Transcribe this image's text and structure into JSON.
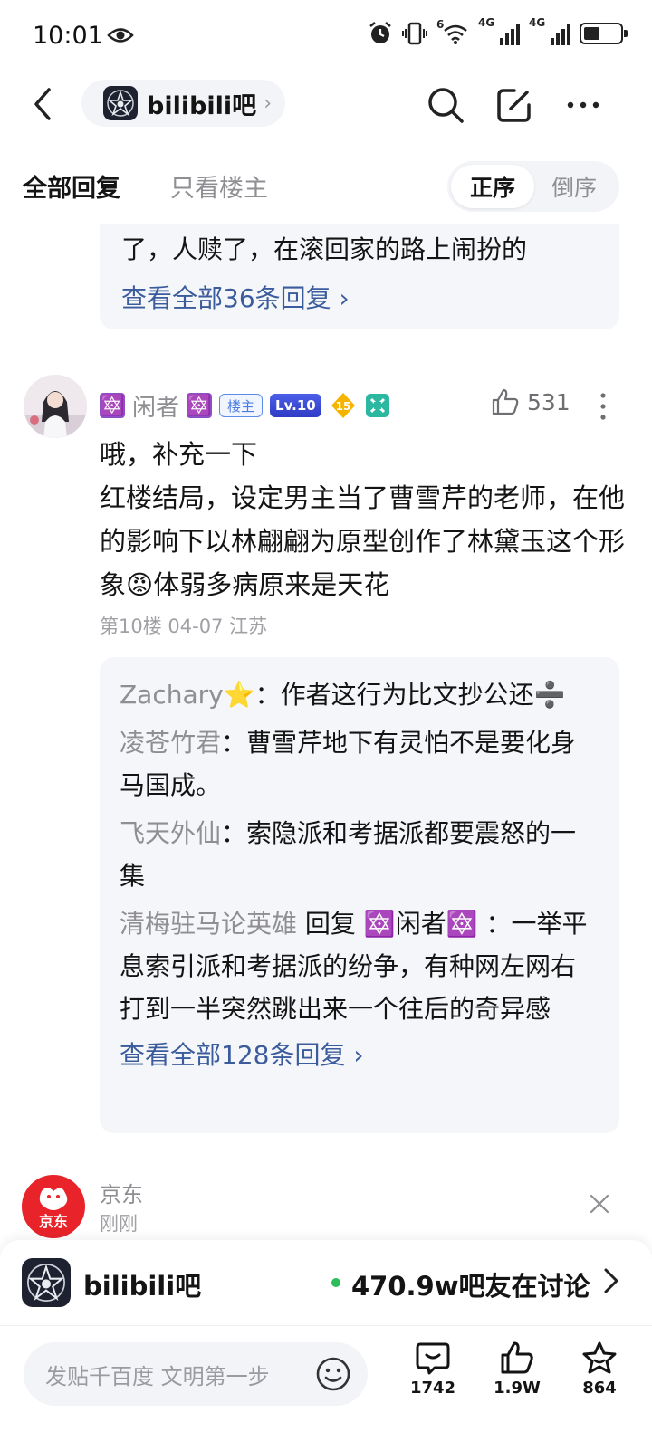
{
  "status_bar": {
    "time": "10:01",
    "signal1_label": "4G",
    "signal2_label": "4G",
    "wifi_label": "6",
    "battery_percent": 45
  },
  "header": {
    "forum_name": "bilibili吧"
  },
  "tabs": {
    "all_replies": "全部回复",
    "op_only": "只看楼主",
    "sort_asc": "正序",
    "sort_desc": "倒序"
  },
  "previous_card": {
    "tail_text": "了，人赎了，在滚回家的路上闹扮的",
    "view_all": "查看全部36条回复 ›"
  },
  "post": {
    "username_prefix": "🔯",
    "username": "闲者",
    "username_suffix": "🔯",
    "host_badge": "楼主",
    "level_badge": "Lv.10",
    "coin_level": "15",
    "likes": "531",
    "body_line1": "哦，补充一下",
    "body_line2": "红楼结局，设定男主当了曹雪芹的老师，在他的影响下以林翩翩为原型创作了林黛玉这个形象",
    "body_emoji": "😡",
    "body_line3": "体弱多病原来是天花",
    "meta": "第10楼  04-07  江苏"
  },
  "sub_replies": [
    {
      "who": "Zachary⭐",
      "text": "：作者这行为比文抄公还➗"
    },
    {
      "who": "凌苍竹君",
      "text": "：曹雪芹地下有灵怕不是要化身马国成。"
    },
    {
      "who": "飞天外仙",
      "text": "：索隐派和考据派都要震怒的一集"
    },
    {
      "who": "清梅驻马论英雄",
      "reply_word": " 回复 ",
      "target": "🔯闲者🔯",
      "text": " ：一举平息索引派和考据派的纷争，有种网左网右打到一半突然跳出来一个往后的奇异感"
    }
  ],
  "sub_view_all": "查看全部128条回复 ›",
  "ad": {
    "logo_text": "京东",
    "name": "京东",
    "time": "刚刚"
  },
  "banner": {
    "forum_name": "bilibili吧",
    "online_text": "470.9w吧友在讨论"
  },
  "bottom_bar": {
    "input_placeholder": "发贴千百度 文明第一步",
    "comments": "1742",
    "likes": "1.9W",
    "favorites": "864"
  },
  "colors": {
    "link_blue": "#3a5c9c",
    "card_bg": "#f5f6f9",
    "online_dot": "#2bbd58",
    "ad_red": "#e8232a"
  }
}
